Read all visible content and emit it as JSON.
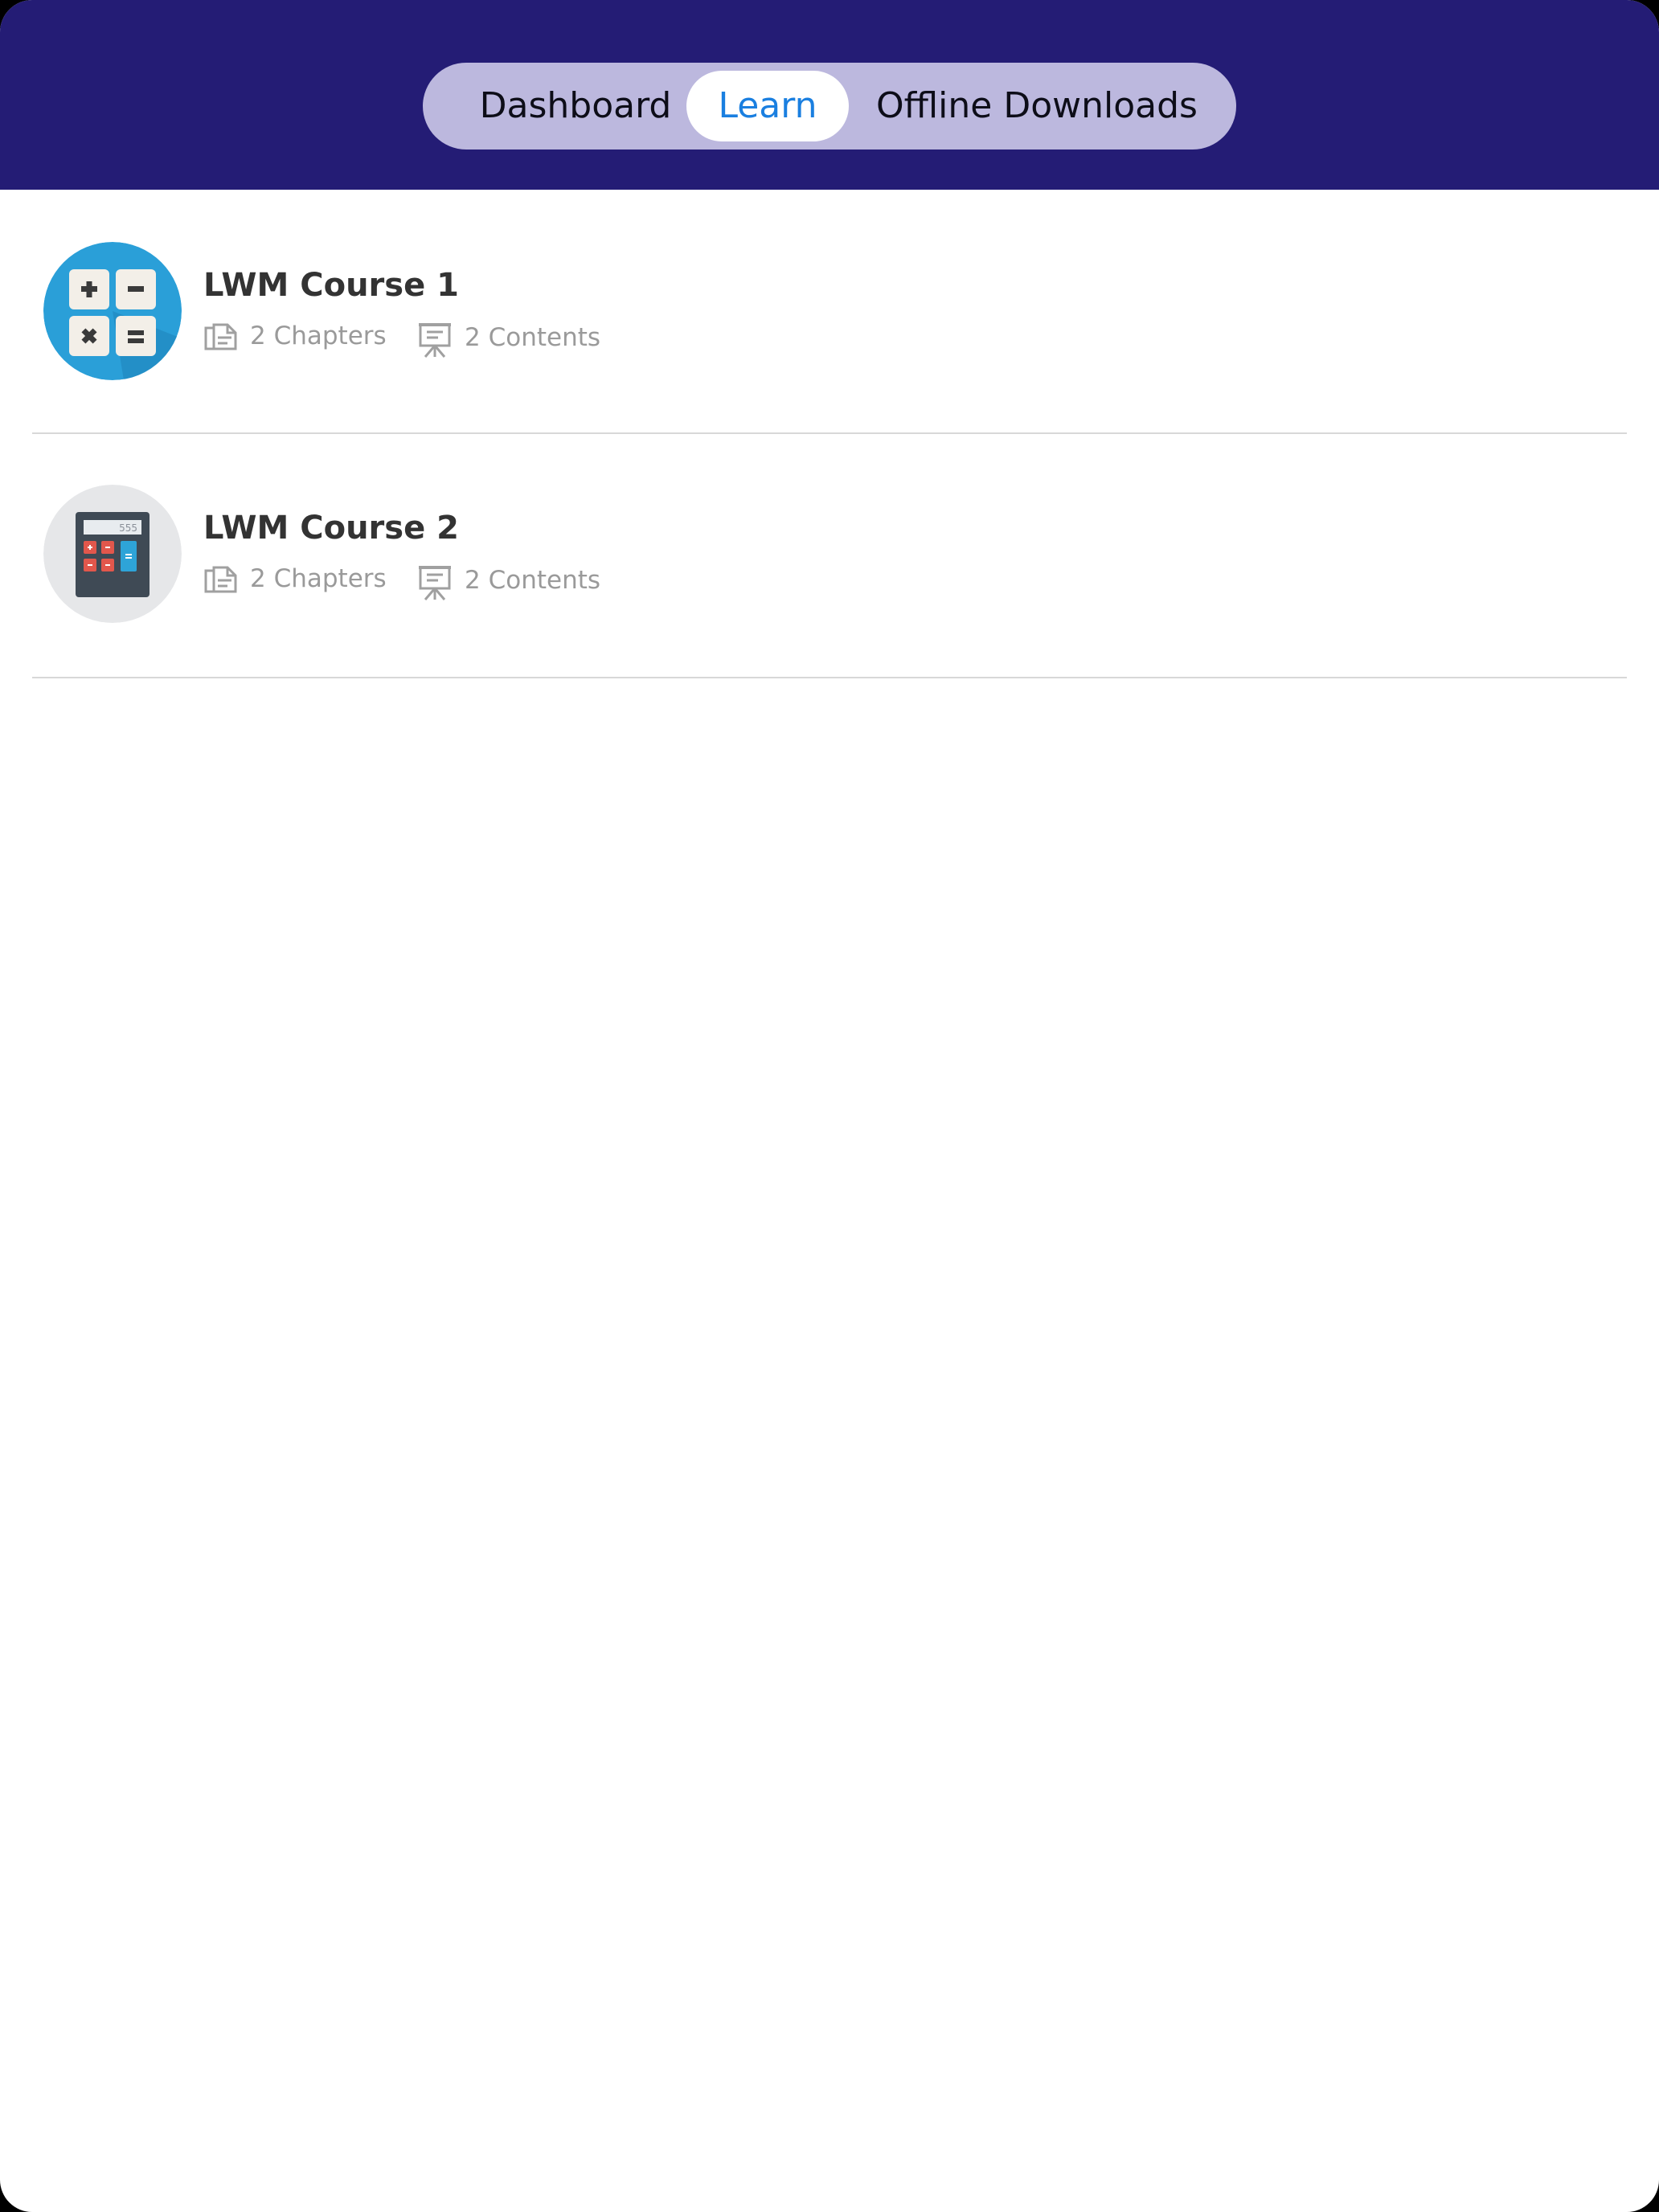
{
  "tabs": [
    {
      "label": "Dashboard",
      "selected": false
    },
    {
      "label": "Learn",
      "selected": true
    },
    {
      "label": "Offline Downloads",
      "selected": false
    }
  ],
  "colors": {
    "header_bg": "#241c75",
    "segment_bg": "#bcb8de",
    "selected_text": "#1a7fe0",
    "meta_text": "#9a9a9a",
    "title_text": "#333333"
  },
  "courses": [
    {
      "title": "LWM Course 1",
      "chapters": "2 Chapters",
      "contents": "2 Contents",
      "thumbnail_icon": "math-operators-icon"
    },
    {
      "title": "LWM Course 2",
      "chapters": "2 Chapters",
      "contents": "2 Contents",
      "thumbnail_icon": "calculator-icon",
      "calculator_display": "555"
    }
  ]
}
